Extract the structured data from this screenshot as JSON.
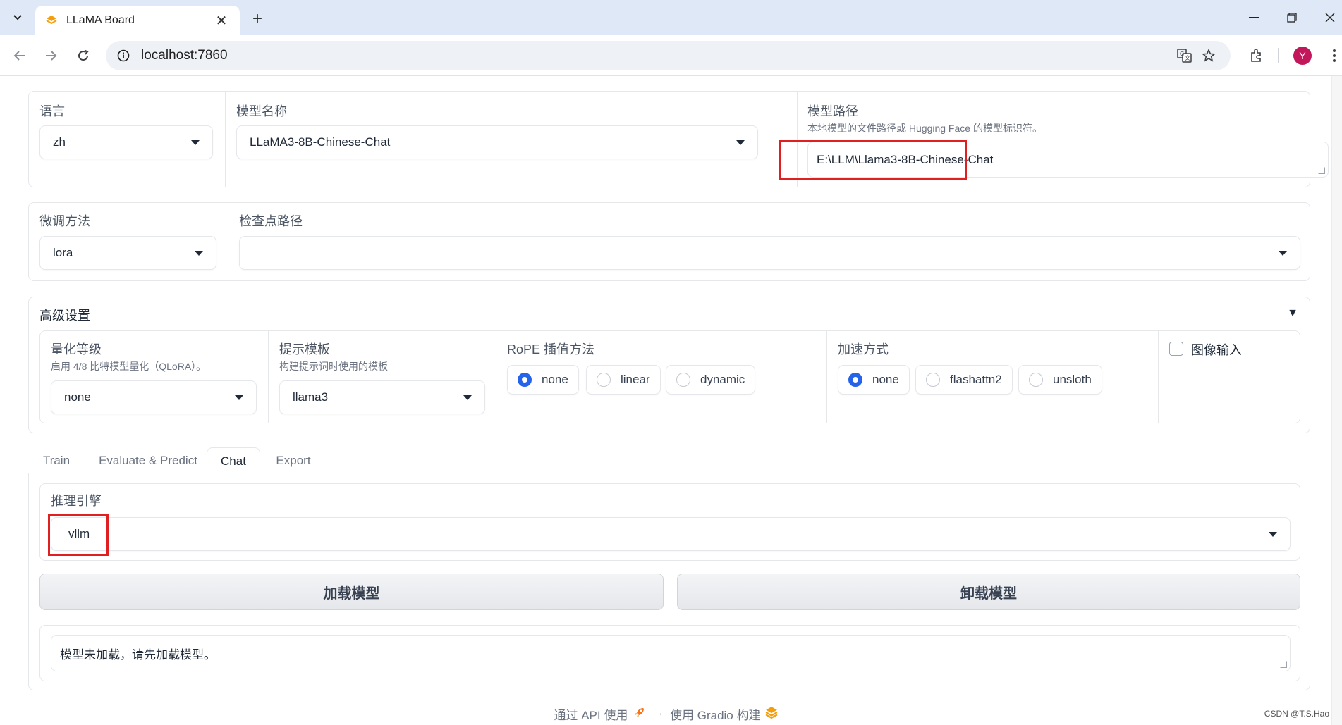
{
  "browser": {
    "tab_title": "LLaMA Board",
    "url": "localhost:7860",
    "avatar_initial": "Y"
  },
  "model_row": {
    "language": {
      "label": "语言",
      "value": "zh"
    },
    "model_name": {
      "label": "模型名称",
      "value": "LLaMA3-8B-Chinese-Chat"
    },
    "model_path": {
      "label": "模型路径",
      "info": "本地模型的文件路径或 Hugging Face 的模型标识符。",
      "value": "E:\\LLM\\Llama3-8B-Chinese-Chat"
    }
  },
  "finetune_row": {
    "method": {
      "label": "微调方法",
      "value": "lora"
    },
    "checkpoint": {
      "label": "检查点路径",
      "value": ""
    }
  },
  "advanced": {
    "title": "高级设置",
    "quantization": {
      "label": "量化等级",
      "info": "启用 4/8 比特模型量化（QLoRA）。",
      "value": "none"
    },
    "template": {
      "label": "提示模板",
      "info": "构建提示词时使用的模板",
      "value": "llama3"
    },
    "rope": {
      "label": "RoPE 插值方法",
      "options": [
        "none",
        "linear",
        "dynamic"
      ],
      "selected": "none"
    },
    "booster": {
      "label": "加速方式",
      "options": [
        "none",
        "flashattn2",
        "unsloth"
      ],
      "selected": "none"
    },
    "visual_input": {
      "label": "图像输入",
      "checked": false
    }
  },
  "tabs": [
    "Train",
    "Evaluate & Predict",
    "Chat",
    "Export"
  ],
  "active_tab": "Chat",
  "chat": {
    "infer_backend": {
      "label": "推理引擎",
      "value": "vllm"
    },
    "load_button": "加载模型",
    "unload_button": "卸载模型",
    "info_box": "模型未加载，请先加载模型。"
  },
  "footer": {
    "api_text": "通过 API 使用",
    "separator": "·",
    "gradio_text": "使用 Gradio 构建"
  },
  "watermark": "CSDN @T.S.Hao",
  "colors": {
    "accent": "#2563eb",
    "highlight_box": "#e02020",
    "brand_orange": "#f59e0b"
  }
}
